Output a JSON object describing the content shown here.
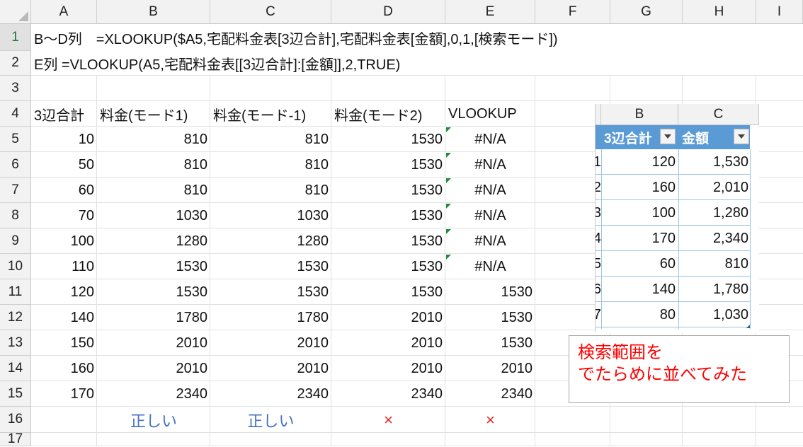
{
  "columns": [
    "A",
    "B",
    "C",
    "D",
    "E",
    "F",
    "G",
    "H",
    "I"
  ],
  "rows": [
    "1",
    "2",
    "3",
    "4",
    "5",
    "6",
    "7",
    "8",
    "9",
    "10",
    "11",
    "12",
    "13",
    "14",
    "15",
    "16",
    "17"
  ],
  "formula_row1": "B～D列　=XLOOKUP($A5,宅配料金表[3辺合計],宅配料金表[金額],0,1,[検索モード])",
  "formula_row2": "E列  =VLOOKUP(A5,宅配料金表[[3辺合計]:[金額]],2,TRUE)",
  "headers": [
    "3辺合計",
    "料金(モード1)",
    "料金(モード-1)",
    "料金(モード2)",
    "VLOOKUP"
  ],
  "data": [
    [
      "10",
      "810",
      "810",
      "1530",
      "#N/A"
    ],
    [
      "50",
      "810",
      "810",
      "1530",
      "#N/A"
    ],
    [
      "60",
      "810",
      "810",
      "1530",
      "#N/A"
    ],
    [
      "70",
      "1030",
      "1030",
      "1530",
      "#N/A"
    ],
    [
      "100",
      "1280",
      "1280",
      "1530",
      "#N/A"
    ],
    [
      "110",
      "1530",
      "1530",
      "1530",
      "#N/A"
    ],
    [
      "120",
      "1530",
      "1530",
      "1530",
      "1530"
    ],
    [
      "140",
      "1780",
      "1780",
      "2010",
      "1530"
    ],
    [
      "150",
      "2010",
      "2010",
      "2010",
      "1530"
    ],
    [
      "160",
      "2010",
      "2010",
      "2010",
      "2010"
    ],
    [
      "170",
      "2340",
      "2340",
      "2340",
      "2340"
    ]
  ],
  "verdicts": [
    "正しい",
    "正しい",
    "×",
    "×"
  ],
  "overlay": {
    "col_headers": [
      "B",
      "C"
    ],
    "table_headers": [
      "3辺合計",
      "金額"
    ],
    "row_index_fragments": [
      "1",
      "2",
      "3",
      "4",
      "5",
      "6",
      "7"
    ],
    "rows": [
      [
        "120",
        "1,530"
      ],
      [
        "160",
        "2,010"
      ],
      [
        "100",
        "1,280"
      ],
      [
        "170",
        "2,340"
      ],
      [
        "60",
        "810"
      ],
      [
        "140",
        "1,780"
      ],
      [
        "80",
        "1,030"
      ]
    ]
  },
  "note": {
    "line1": "検索範囲を",
    "line2": "でたらめに並べてみた"
  },
  "colors": {
    "header_bg": "#f2f2f2",
    "table_header": "#5b9bd5",
    "verdict_ok": "#4472c4",
    "verdict_ng": "#e0201b",
    "note_text": "#ff0000",
    "error_flag": "#1e8c3a"
  }
}
